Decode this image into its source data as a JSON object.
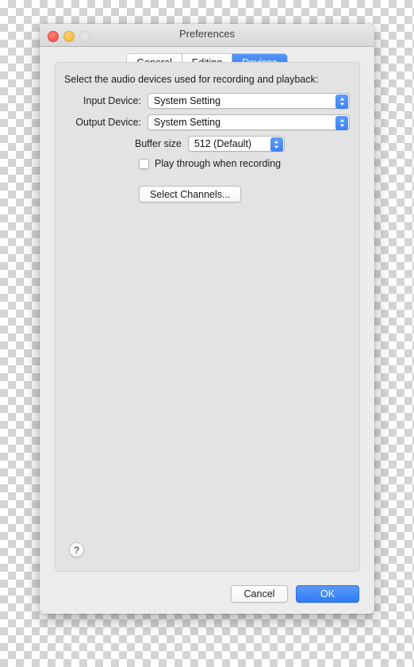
{
  "window": {
    "title": "Preferences",
    "traffic_lights": [
      "close-button",
      "minimize-button",
      "zoom-button"
    ]
  },
  "tabs": [
    {
      "label": "General",
      "selected": false
    },
    {
      "label": "Editing",
      "selected": false
    },
    {
      "label": "Devices",
      "selected": true
    }
  ],
  "devices_pane": {
    "intro": "Select the audio devices used for recording and playback:",
    "input_device": {
      "label": "Input Device:",
      "value": "System Setting"
    },
    "output_device": {
      "label": "Output Device:",
      "value": "System Setting"
    },
    "buffer_size": {
      "label": "Buffer size",
      "value": "512 (Default)"
    },
    "play_through": {
      "label": "Play through when recording",
      "checked": false
    },
    "select_channels_label": "Select Channels...",
    "help_label": "?"
  },
  "footer": {
    "cancel_label": "Cancel",
    "ok_label": "OK"
  },
  "colors": {
    "accent": "#2f7df5",
    "window_bg": "#ececec",
    "panel_bg": "#e3e3e3",
    "text": "#1c1c1c"
  }
}
